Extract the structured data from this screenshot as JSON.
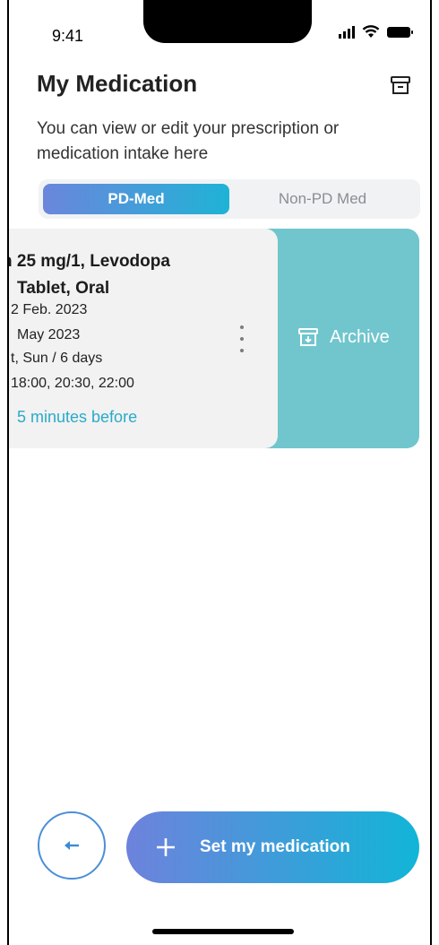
{
  "status_bar": {
    "time": "9:41"
  },
  "header": {
    "title": "My Medication",
    "subtitle": "You can view or edit your prescription or medication intake here"
  },
  "tabs": [
    {
      "label": "PD-Med",
      "active": true
    },
    {
      "label": "Non-PD Med",
      "active": false
    }
  ],
  "medication_card": {
    "title_line1": "n 25 mg/1, Levodopa",
    "title_line2": "Tablet, Oral",
    "start_date": "2 Feb. 2023",
    "end_date": "May 2023",
    "days": "t, Sun / 6 days",
    "times": "18:00, 20:30, 22:00",
    "reminder": "5 minutes before"
  },
  "swipe_action": {
    "label": "Archive"
  },
  "bottom": {
    "set_button_label": "Set my medication"
  },
  "colors": {
    "accent_gradient_start": "#6e82dc",
    "accent_gradient_end": "#11b5d7",
    "archive_bg": "#71c6cd",
    "reminder_text": "#2aaac9"
  }
}
